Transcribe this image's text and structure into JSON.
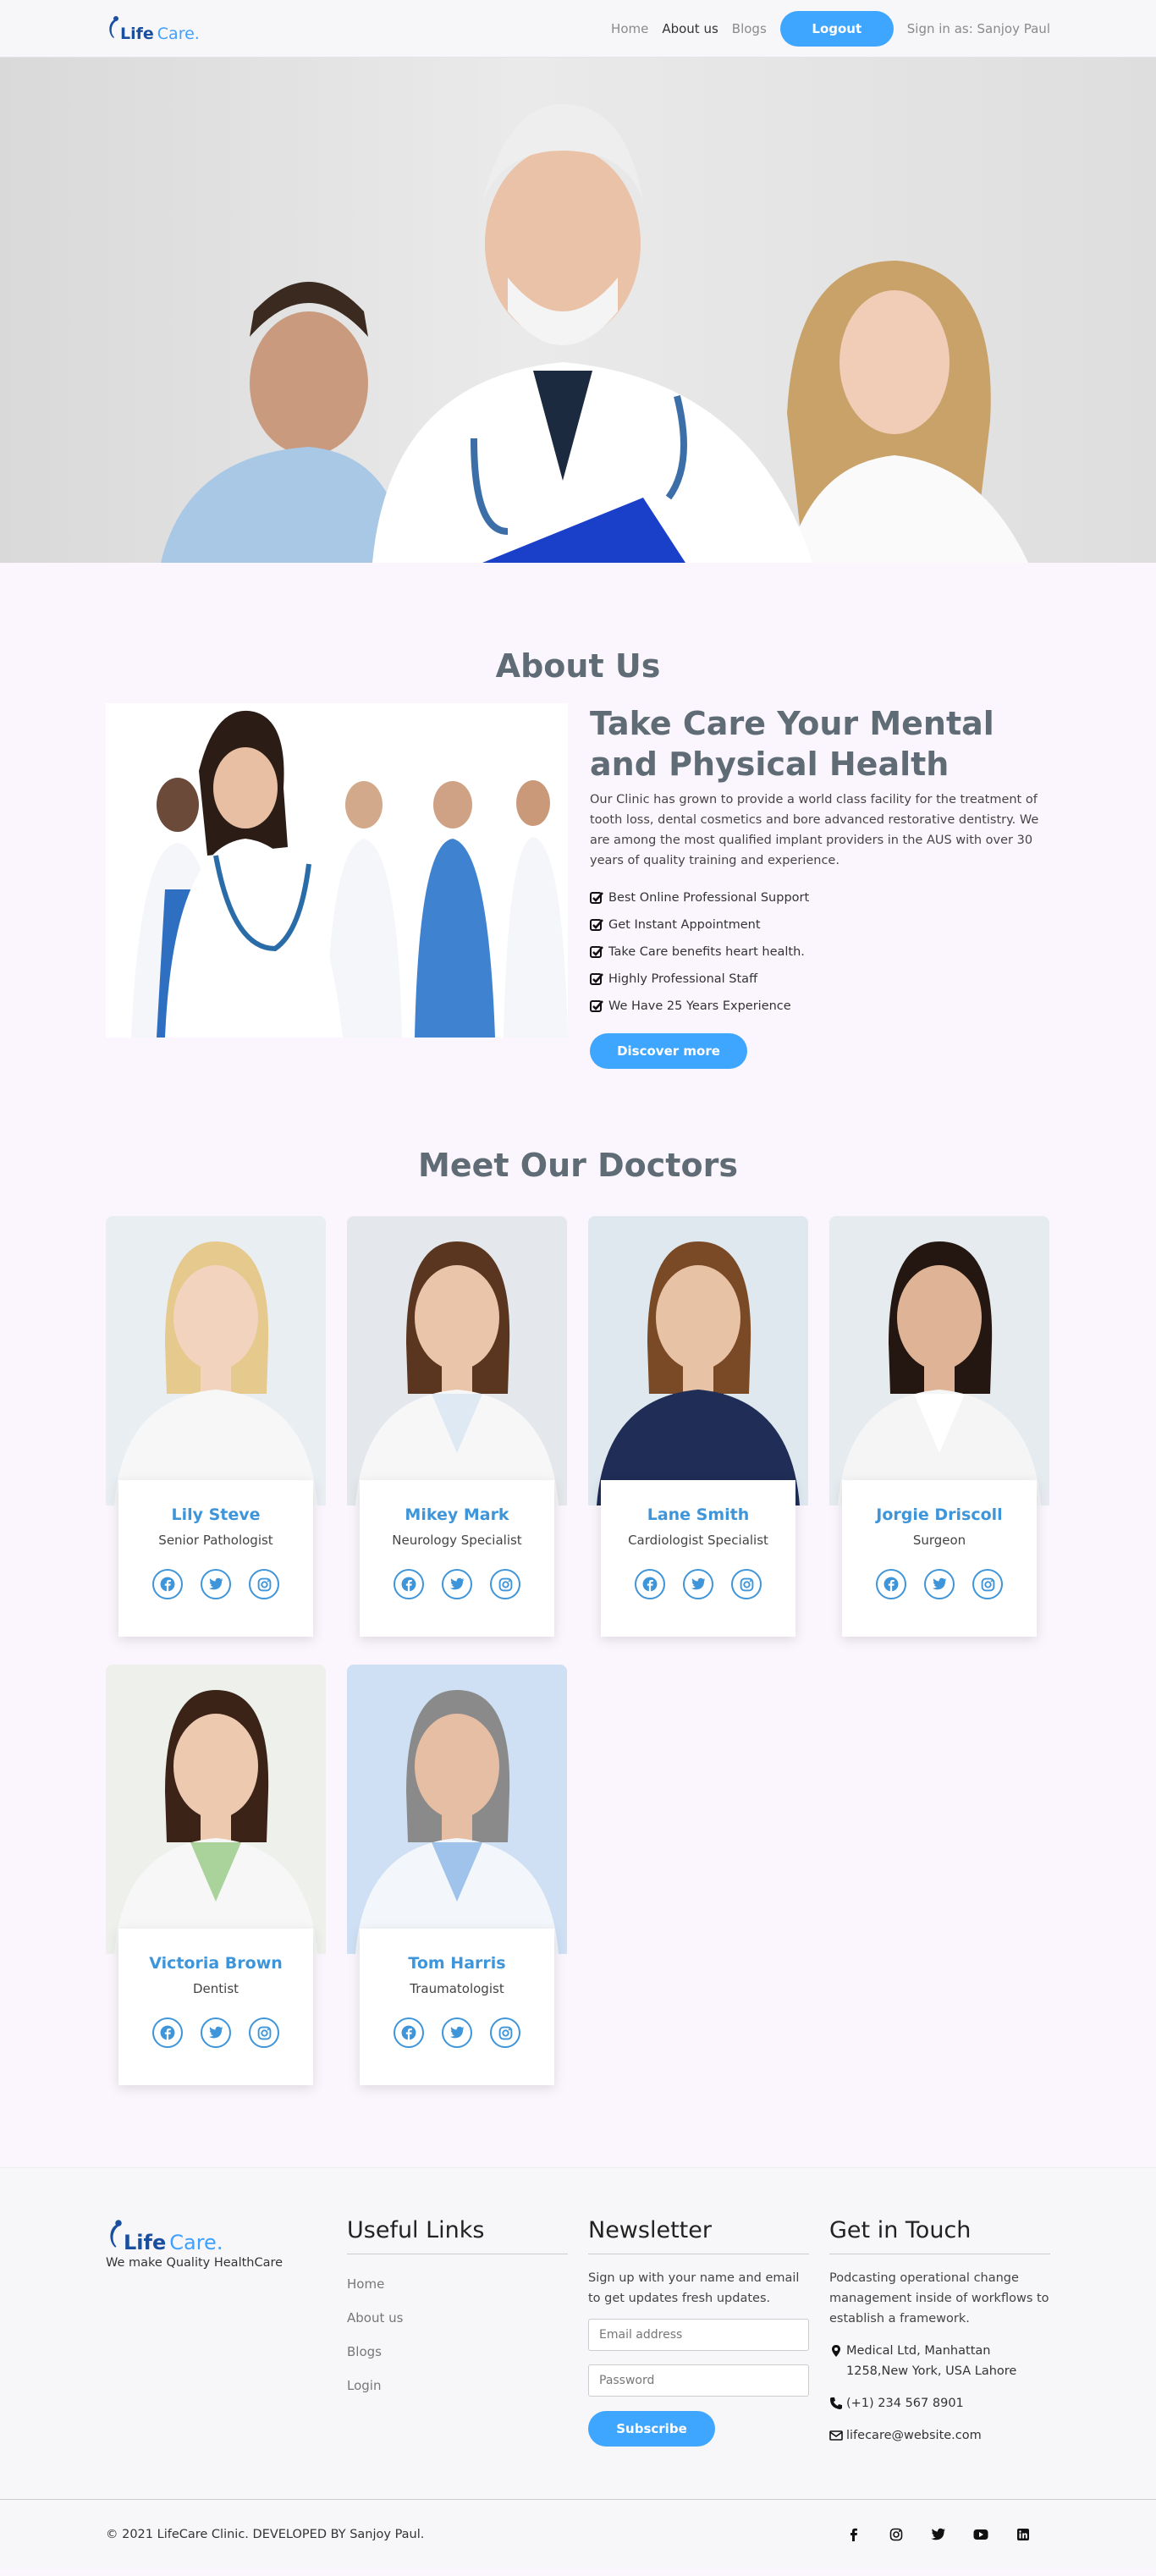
{
  "brand": {
    "name_part1": "Life",
    "name_part2": "Care.",
    "primary": "#3fa6ff",
    "title_color": "#5f6b75",
    "name_color": "#3f95d9"
  },
  "nav": {
    "links": [
      "Home",
      "About us",
      "Blogs"
    ],
    "active": "About us",
    "logout_label": "Logout",
    "signin_text": "Sign in as: Sanjoy Paul"
  },
  "about": {
    "section_title": "About Us",
    "heading": "Take Care Your Mental and Physical Health",
    "paragraph": "Our Clinic has grown to provide a world class facility for the treatment of tooth loss, dental cosmetics and bore advanced restorative dentistry. We are among the most qualified implant providers in the AUS with over 30 years of quality training and experience.",
    "features": [
      "Best Online Professional Support",
      "Get Instant Appointment",
      "Take Care benefits heart health.",
      "Highly Professional Staff",
      "We Have 25 Years Experience"
    ],
    "button": "Discover more"
  },
  "doctors": {
    "section_title": "Meet Our Doctors",
    "list": [
      {
        "name": "Lily Steve",
        "role": "Senior Pathologist"
      },
      {
        "name": "Mikey Mark",
        "role": "Neurology Specialist"
      },
      {
        "name": "Lane Smith",
        "role": "Cardiologist Specialist"
      },
      {
        "name": "Jorgie Driscoll",
        "role": "Surgeon"
      },
      {
        "name": "Victoria Brown",
        "role": "Dentist"
      },
      {
        "name": "Tom Harris",
        "role": "Traumatologist"
      }
    ],
    "social_icons": [
      "facebook-icon",
      "twitter-icon",
      "instagram-icon"
    ]
  },
  "footer": {
    "tagline": "We make Quality HealthCare",
    "useful_links_title": "Useful Links",
    "useful_links": [
      "Home",
      "About us",
      "Blogs",
      "Login"
    ],
    "newsletter_title": "Newsletter",
    "newsletter_text": "Sign up with your name and email to get updates fresh updates.",
    "email_placeholder": "Email address",
    "password_placeholder": "Password",
    "subscribe_label": "Subscribe",
    "contact_title": "Get in Touch",
    "contact_text": "Podcasting operational change management inside of workflows to establish a framework.",
    "address": "Medical Ltd, Manhattan 1258,New York, USA Lahore",
    "phone": "(+1) 234 567 8901",
    "email": "lifecare@website.com",
    "copyright": "© 2021 LifeCare Clinic. DEVELOPED BY Sanjoy Paul.",
    "social_icons": [
      "facebook-icon",
      "instagram-icon",
      "twitter-icon",
      "youtube-icon",
      "linkedin-icon"
    ]
  }
}
